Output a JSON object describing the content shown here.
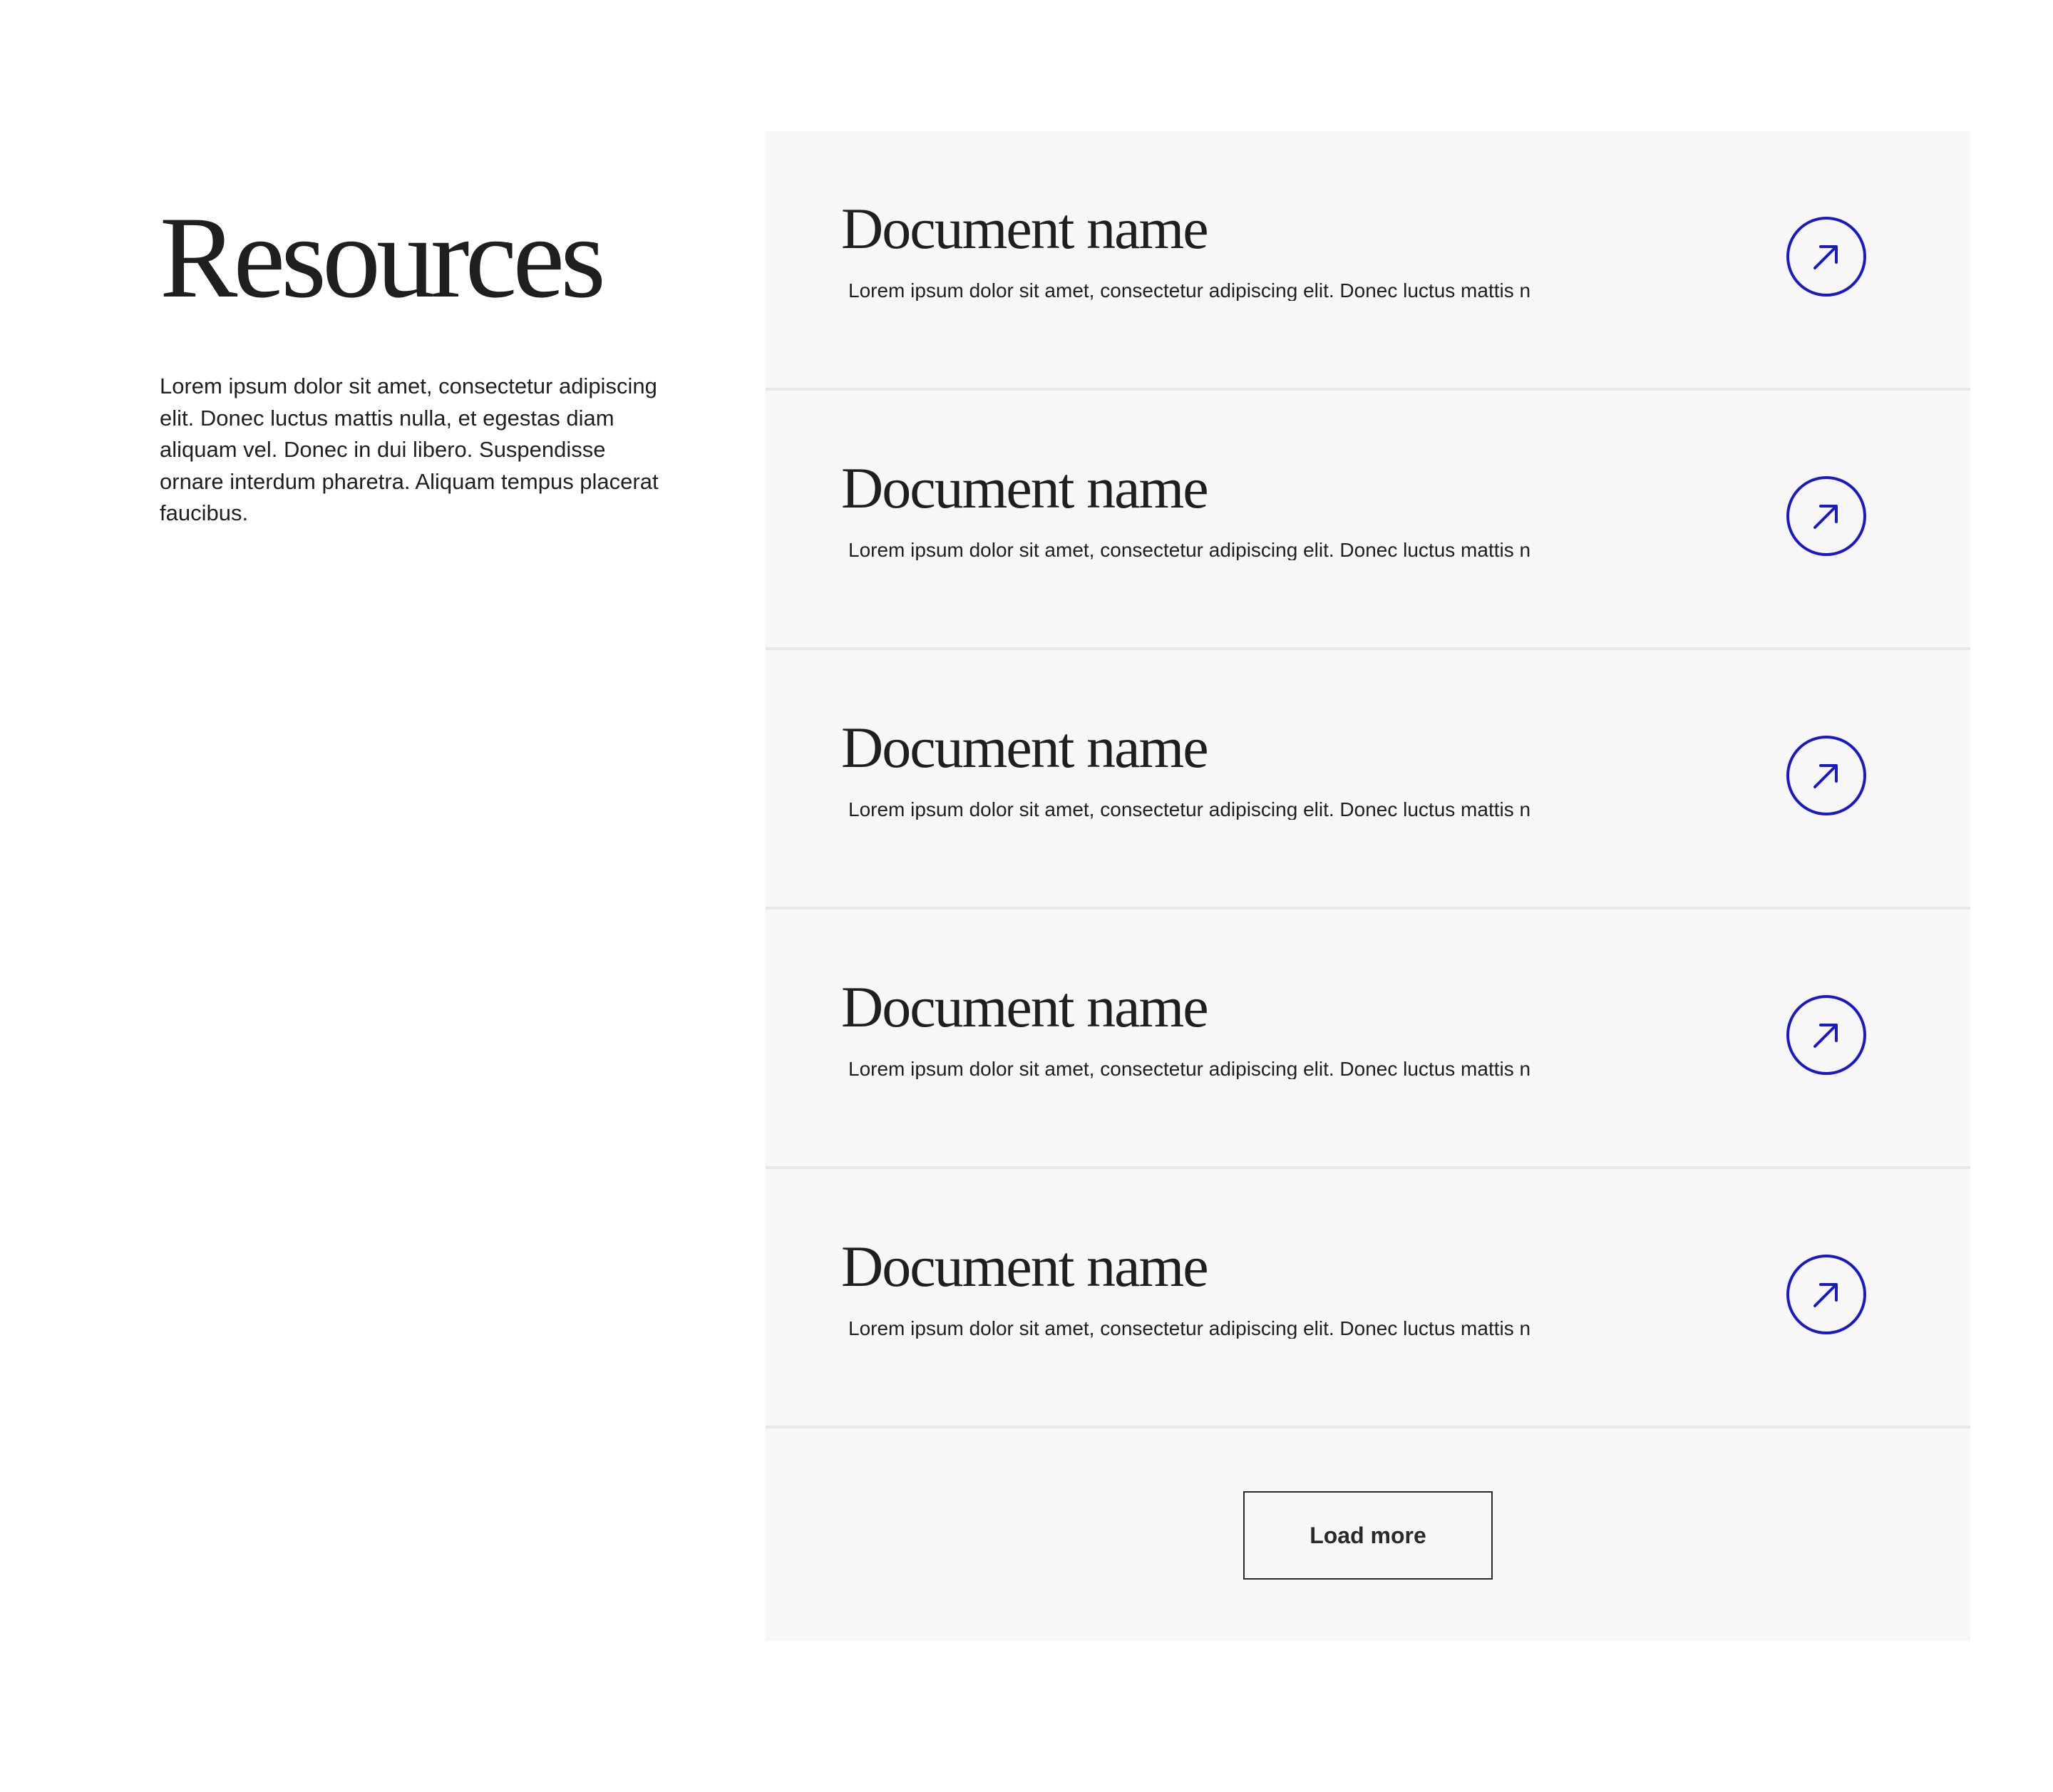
{
  "intro": {
    "title": "Resources",
    "description": "Lorem ipsum dolor sit amet, consectetur adipiscing elit. Donec luctus mattis nulla, et egestas diam aliquam vel. Donec in dui libero. Suspendisse ornare interdum pharetra. Aliquam tempus placerat faucibus."
  },
  "documents": [
    {
      "title": "Document name",
      "description": "Lorem ipsum dolor sit amet, consectetur adipiscing elit. Donec luctus mattis n",
      "icon": "arrow-up-right-icon"
    },
    {
      "title": "Document name",
      "description": "Lorem ipsum dolor sit amet, consectetur adipiscing elit. Donec luctus mattis n",
      "icon": "arrow-up-right-icon"
    },
    {
      "title": "Document name",
      "description": "Lorem ipsum dolor sit amet, consectetur adipiscing elit. Donec luctus mattis n",
      "icon": "arrow-up-right-icon"
    },
    {
      "title": "Document name",
      "description": "Lorem ipsum dolor sit amet, consectetur adipiscing elit. Donec luctus mattis n",
      "icon": "arrow-up-right-icon"
    },
    {
      "title": "Document name",
      "description": "Lorem ipsum dolor sit amet, consectetur adipiscing elit. Donec luctus mattis n",
      "icon": "arrow-up-right-icon"
    }
  ],
  "load_more": {
    "label": "Load more"
  },
  "colors": {
    "accent": "#1919c8",
    "panel_background": "#f7f7f7",
    "text": "#1f1f1f",
    "divider": "#e7e7e7"
  }
}
